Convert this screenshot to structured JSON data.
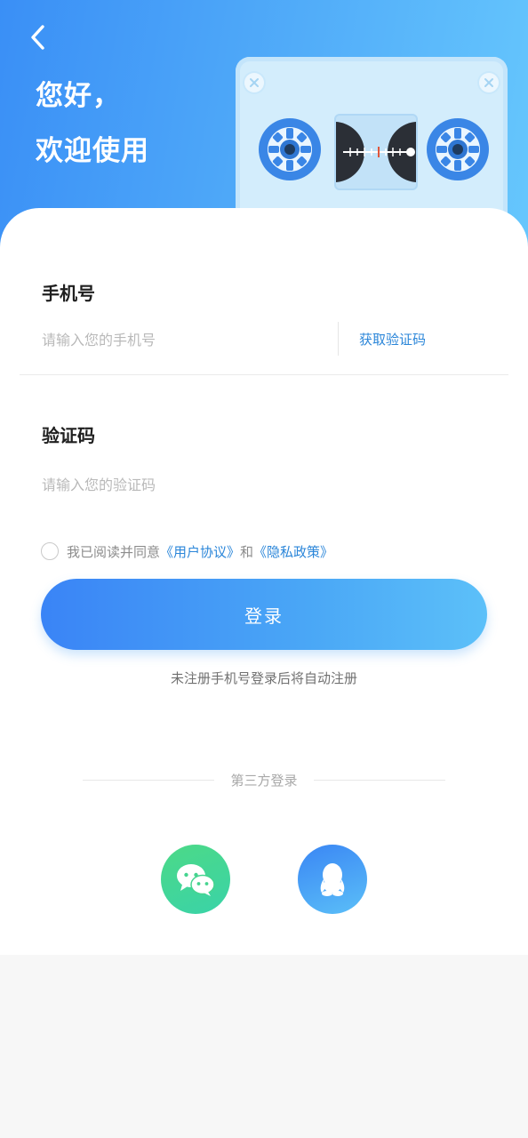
{
  "header": {
    "greeting_line1": "您好，",
    "greeting_line2": "欢迎使用",
    "back_icon": "chevron-left-icon"
  },
  "form": {
    "phone": {
      "label": "手机号",
      "placeholder": "请输入您的手机号",
      "value": ""
    },
    "get_code_label": "获取验证码",
    "code": {
      "label": "验证码",
      "placeholder": "请输入您的验证码",
      "value": ""
    },
    "agreement": {
      "prefix": "我已阅读并同意",
      "user_agreement": "《用户协议》",
      "conjunction": "和",
      "privacy_policy": "《隐私政策》",
      "checked": false
    },
    "login_label": "登录",
    "hint": "未注册手机号登录后将自动注册"
  },
  "third_party": {
    "title": "第三方登录",
    "options": [
      {
        "icon": "wechat-icon"
      },
      {
        "icon": "qq-icon"
      }
    ]
  },
  "colors": {
    "accent": "#3a8ff6",
    "link": "#2b86d9",
    "wechat": "#4cd987",
    "qq": "#3a86f4"
  }
}
